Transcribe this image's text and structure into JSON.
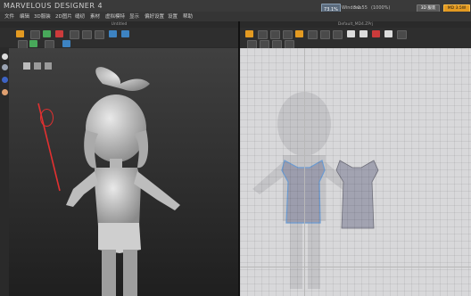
{
  "app": {
    "title": "MARVELOUS DESIGNER 4",
    "menu": [
      "文件",
      "编辑",
      "3D服装",
      "2D图片",
      "缝纫",
      "素材",
      "虚拟模特",
      "显示",
      "偏好设置",
      "设置",
      "帮助"
    ]
  },
  "top_right": {
    "badge": "73.1%",
    "stat1": "Windows",
    "stat2": "3.1.55",
    "stat3": "(1000%)",
    "btn1": "3D 服装",
    "btn2": "MD 3.5W"
  },
  "panels": {
    "left_title": "Untitled",
    "right_title": "Default_MD4.ZPrj"
  },
  "colors": {
    "accent": "#e39a21",
    "annotation": "#e23030",
    "patternSelected": "#6b9bd2",
    "patternFill": "#9c9dad"
  },
  "icons": {
    "annotation_icon": "circle-highlight-icon",
    "arrow_icon": "pointer-arrow-icon"
  }
}
